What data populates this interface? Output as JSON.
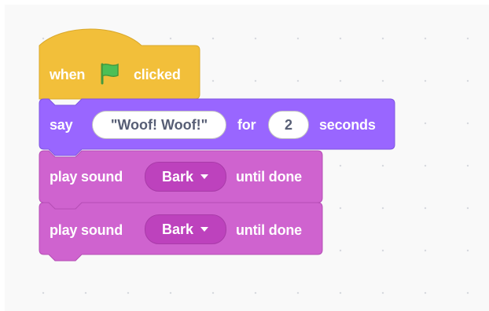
{
  "colors": {
    "events": "#ffbf00",
    "looks": "#9966ff",
    "sound": "#cf63cf",
    "flag": "#4cbf56"
  },
  "script": {
    "hat": {
      "when": "when",
      "flag_icon": "green-flag-icon",
      "clicked": "clicked"
    },
    "say": {
      "say": "say",
      "message": "\"Woof! Woof!\"",
      "for": "for",
      "secs": "2",
      "seconds": "seconds"
    },
    "sound1": {
      "play": "play sound",
      "sound": "Bark",
      "until": "until done"
    },
    "sound2": {
      "play": "play sound",
      "sound": "Bark",
      "until": "until done"
    }
  }
}
